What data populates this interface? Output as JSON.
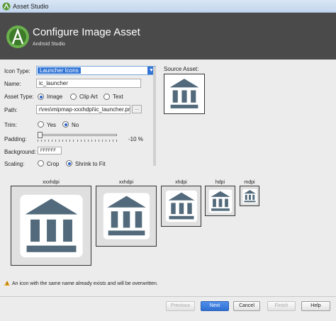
{
  "window": {
    "title": "Asset Studio"
  },
  "header": {
    "title": "Configure Image Asset",
    "subtitle": "Android Studio"
  },
  "form": {
    "icon_type": {
      "label": "Icon Type:",
      "value": "Launcher Icons"
    },
    "name": {
      "label": "Name:",
      "value": "ic_launcher"
    },
    "asset_type": {
      "label": "Asset Type:",
      "options": [
        "Image",
        "Clip Art",
        "Text"
      ],
      "selected": "Image"
    },
    "path": {
      "label": "Path:",
      "value": "r\\res\\mipmap-xxxhdpi\\ic_launcher.png",
      "browse_label": "..."
    },
    "trim": {
      "label": "Trim:",
      "options": [
        "Yes",
        "No"
      ],
      "selected": "No"
    },
    "padding": {
      "label": "Padding:",
      "value_text": "-10 %",
      "level": 0
    },
    "background": {
      "label": "Background:",
      "value": "FFFFFF"
    },
    "scaling": {
      "label": "Scaling:",
      "options": [
        "Crop",
        "Shrink to Fit"
      ],
      "selected": "Shrink to Fit"
    }
  },
  "source_asset": {
    "label": "Source Asset:"
  },
  "previews": [
    {
      "density": "xxxhdpi"
    },
    {
      "density": "xxhdpi"
    },
    {
      "density": "xhdpi"
    },
    {
      "density": "hdpi"
    },
    {
      "density": "mdpi"
    }
  ],
  "warning": {
    "text": "An icon with the same name already exists and will be overwritten."
  },
  "buttons": {
    "previous": "Previous",
    "next": "Next",
    "cancel": "Cancel",
    "finish": "Finish",
    "help": "Help"
  },
  "colors": {
    "header_bg": "#4a4a4a",
    "accent": "#3375d6",
    "icon_blue": "#526a7b",
    "warning": "#e8a317"
  }
}
